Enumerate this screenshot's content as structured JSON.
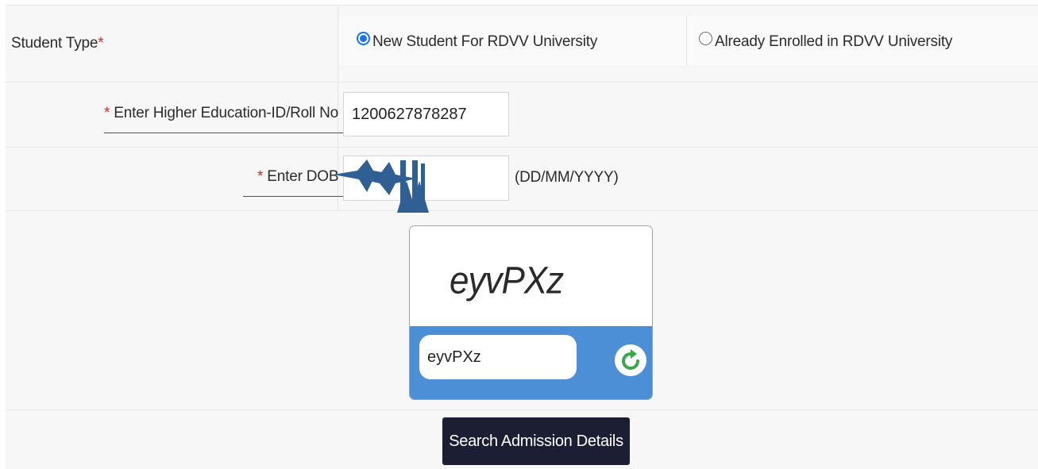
{
  "student_type": {
    "label": "Student Type",
    "required_mark": "*",
    "options": [
      {
        "label": "New Student For RDVV University",
        "selected": true
      },
      {
        "label": "Already Enrolled in RDVV University",
        "selected": false
      }
    ]
  },
  "roll_field": {
    "required_mark": "*",
    "label": "Enter Higher Education-ID/Roll No",
    "value": "1200627878287"
  },
  "dob_field": {
    "required_mark": "*",
    "label": "Enter DOB",
    "value": "",
    "format_hint": "(DD/MM/YYYY)"
  },
  "captcha": {
    "image_text": "eyvPXz",
    "input_value": "eyvPXz",
    "refresh_icon": "refresh-icon"
  },
  "search_button": {
    "label": "Search Admission Details"
  },
  "colors": {
    "primary_radio": "#1a73e8",
    "required": "#e0252b",
    "captcha_band": "#4d8fd6",
    "button_bg": "#1c1e34",
    "redaction_stars": "#2f5f93"
  }
}
